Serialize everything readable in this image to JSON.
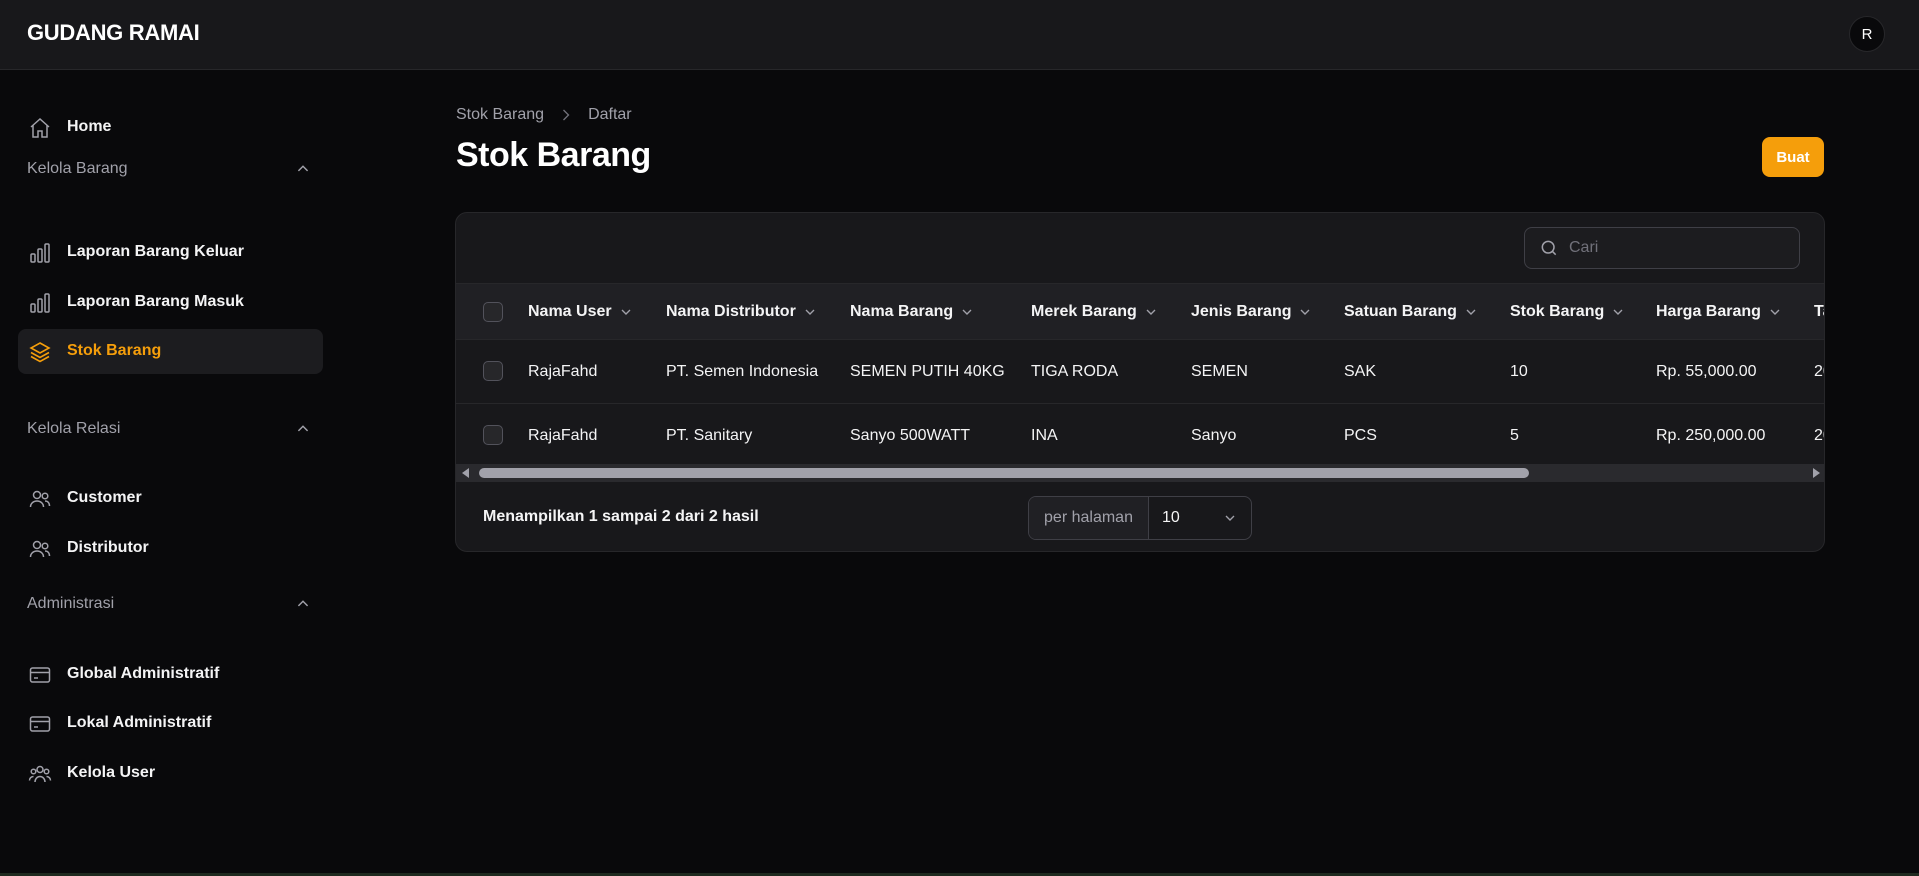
{
  "app": {
    "brand": "GUDANG RAMAI",
    "user_initial": "R"
  },
  "sidebar": {
    "home": "Home",
    "groups": [
      {
        "label": "Kelola Barang",
        "items": [
          "Laporan Barang Keluar",
          "Laporan Barang Masuk",
          "Stok Barang"
        ]
      },
      {
        "label": "Kelola Relasi",
        "items": [
          "Customer",
          "Distributor"
        ]
      },
      {
        "label": "Administrasi",
        "items": [
          "Global Administratif",
          "Lokal Administratif",
          "Kelola User"
        ]
      }
    ],
    "active_item": "Stok Barang"
  },
  "breadcrumb": [
    "Stok Barang",
    "Daftar"
  ],
  "page": {
    "title": "Stok Barang",
    "create_label": "Buat"
  },
  "search": {
    "placeholder": "Cari",
    "value": ""
  },
  "table": {
    "columns": [
      "Nama User",
      "Nama Distributor",
      "Nama Barang",
      "Merek Barang",
      "Jenis Barang",
      "Satuan Barang",
      "Stok Barang",
      "Harga Barang",
      "Ta"
    ],
    "rows": [
      [
        "RajaFahd",
        "PT. Semen Indonesia",
        "SEMEN PUTIH 40KG",
        "TIGA RODA",
        "SEMEN",
        "SAK",
        "10",
        "Rp. 55,000.00",
        "20"
      ],
      [
        "RajaFahd",
        "PT. Sanitary",
        "Sanyo 500WATT",
        "INA",
        "Sanyo",
        "PCS",
        "5",
        "Rp. 250,000.00",
        "20"
      ]
    ]
  },
  "pagination": {
    "summary": "Menampilkan 1 sampai 2 dari 2 hasil",
    "per_page_label": "per halaman",
    "per_page_value": "10"
  },
  "colors": {
    "accent": "#f59e0b",
    "background": "#09090b",
    "surface": "#18181b"
  },
  "icons": {
    "home": "home-icon",
    "report": "bar-chart-icon",
    "stock": "layers-icon",
    "customer": "users-icon",
    "distributor": "users-icon",
    "admin": "credit-card-icon",
    "users": "user-group-icon"
  }
}
